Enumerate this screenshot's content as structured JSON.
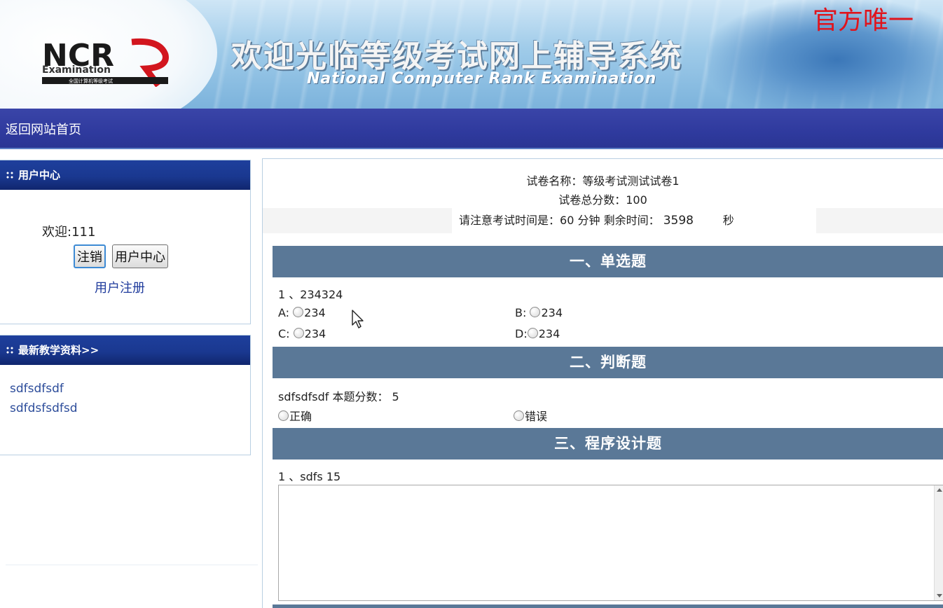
{
  "banner": {
    "logo_letters": "NCR",
    "logo_word": "Examination",
    "logo_cn": "全国计算机等级考试",
    "title": "欢迎光临等级考试网上辅导系统",
    "subtitle": "National Computer Rank Examination",
    "official": "官方唯一"
  },
  "nav": {
    "home_link": "返回网站首页"
  },
  "user_center": {
    "heading": "用户中心",
    "welcome": "欢迎:111",
    "logout_label": "注销",
    "center_label": "用户中心",
    "register_link": "用户注册"
  },
  "resources": {
    "heading": "最新教学资料>>",
    "items": [
      "sdfsdfsdf",
      "sdfdsfsdfsd"
    ]
  },
  "exam": {
    "paper_name": "试卷名称：等级考试测试试卷1",
    "total_score": "试卷总分数：100",
    "time_prefix": "请注意考试时间是：",
    "time_minutes": "60",
    "time_unit": "分钟",
    "remaining_label": "剩余时间：",
    "remaining_seconds": "3598",
    "seconds_unit": "秒"
  },
  "sections": {
    "single": {
      "title": "一、单选题",
      "question": "1 、234324",
      "options": [
        {
          "key": "A:",
          "value": "234"
        },
        {
          "key": "B:",
          "value": "234"
        },
        {
          "key": "C:",
          "value": "234"
        },
        {
          "key": "D:",
          "value": "234"
        }
      ]
    },
    "judge": {
      "title": "二、判断题",
      "question": "sdfsdfsdf 本题分数： 5",
      "true_label": "正确",
      "false_label": "错误"
    },
    "program": {
      "title": "三、程序设计题",
      "question": "1 、sdfs 15",
      "answer_value": ""
    }
  },
  "colors": {
    "nav_bg": "#2f3a9e",
    "section_bg": "#5a7897",
    "panel_head_bg": "#1a3890",
    "official_red": "#e0141c",
    "link_blue": "#2c4c9a"
  }
}
